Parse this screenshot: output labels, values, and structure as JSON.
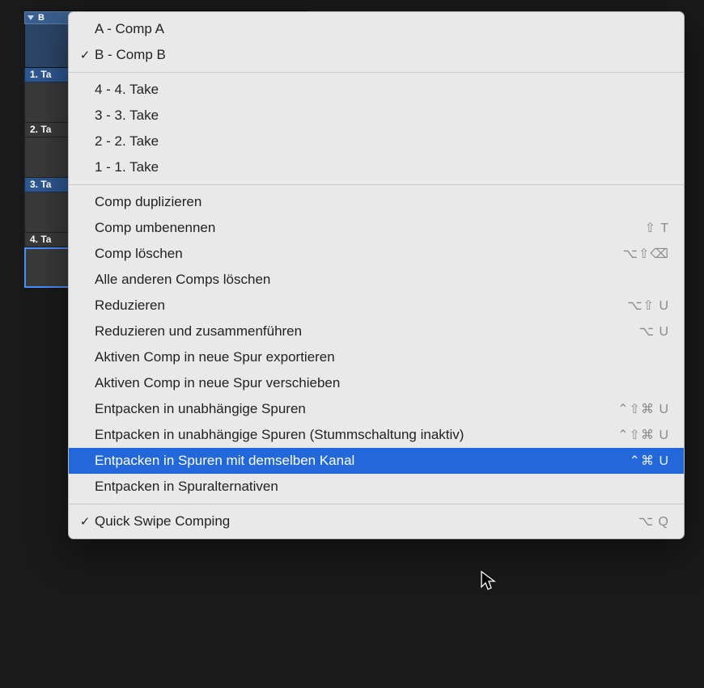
{
  "folder": {
    "label": "B"
  },
  "takes": [
    {
      "label": "1. Ta"
    },
    {
      "label": "2. Ta"
    },
    {
      "label": "3. Ta"
    },
    {
      "label": "4. Ta"
    }
  ],
  "menu": {
    "comps": [
      {
        "label": "A - Comp A",
        "checked": false
      },
      {
        "label": "B - Comp B",
        "checked": true
      }
    ],
    "take_items": [
      {
        "label": "4 - 4. Take"
      },
      {
        "label": "3 - 3. Take"
      },
      {
        "label": "2 - 2. Take"
      },
      {
        "label": "1 - 1. Take"
      }
    ],
    "actions": [
      {
        "label": "Comp duplizieren",
        "shortcut": ""
      },
      {
        "label": "Comp umbenennen",
        "shortcut": "⇧ T"
      },
      {
        "label": "Comp löschen",
        "shortcut": "⌥⇧⌫"
      },
      {
        "label": "Alle anderen Comps löschen",
        "shortcut": ""
      },
      {
        "label": "Reduzieren",
        "shortcut": "⌥⇧ U"
      },
      {
        "label": "Reduzieren und zusammenführen",
        "shortcut": "⌥ U"
      },
      {
        "label": "Aktiven Comp in neue Spur exportieren",
        "shortcut": ""
      },
      {
        "label": "Aktiven Comp in neue Spur verschieben",
        "shortcut": ""
      },
      {
        "label": "Entpacken in unabhängige Spuren",
        "shortcut": "⌃⇧⌘ U"
      },
      {
        "label": "Entpacken in unabhängige Spuren (Stummschaltung inaktiv)",
        "shortcut": "⌃⇧⌘ U"
      },
      {
        "label": "Entpacken in Spuren mit demselben Kanal",
        "shortcut": "⌃⌘ U",
        "highlighted": true
      },
      {
        "label": "Entpacken in Spuralternativen",
        "shortcut": ""
      }
    ],
    "footer": [
      {
        "label": "Quick Swipe Comping",
        "shortcut": "⌥ Q",
        "checked": true
      }
    ]
  }
}
